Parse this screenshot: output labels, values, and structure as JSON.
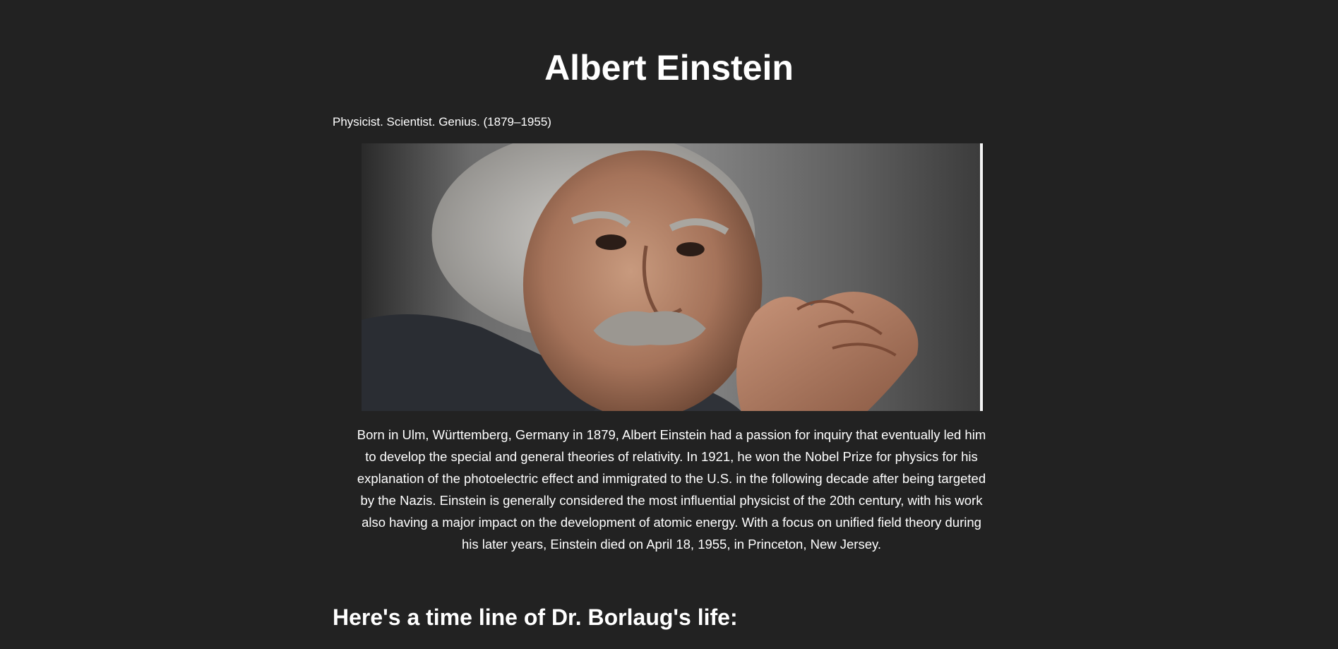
{
  "header": {
    "title": "Albert Einstein",
    "tagline": "Physicist. Scientist. Genius. (1879–1955)"
  },
  "image": {
    "alt": "Albert Einstein portrait"
  },
  "main": {
    "bio": "Born in Ulm, Württemberg, Germany in 1879, Albert Einstein had a passion for inquiry that eventually led him to develop the special and general theories of relativity. In 1921, he won the Nobel Prize for physics for his explanation of the photoelectric effect and immigrated to the U.S. in the following decade after being targeted by the Nazis. Einstein is generally considered the most influential physicist of the 20th century, with his work also having a major impact on the development of atomic energy. With a focus on unified field theory during his later years, Einstein died on April 18, 1955, in Princeton, New Jersey.",
    "timeline_heading": "Here's a time line of Dr. Borlaug's life:"
  },
  "colors": {
    "background": "#222222",
    "text": "#ffffff"
  }
}
